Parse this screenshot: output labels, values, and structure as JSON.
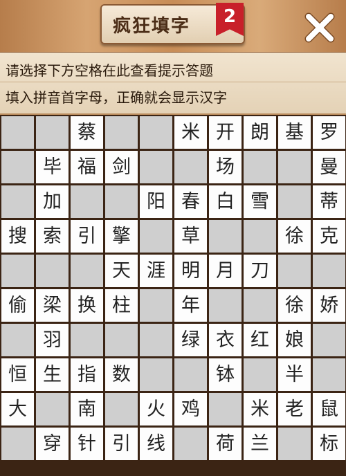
{
  "header": {
    "title": "疯狂填字",
    "badge": "2",
    "close_icon": "close-x-icon"
  },
  "hint": {
    "line1": "请选择下方空格在此查看提示答题",
    "line2": "填入拼音首字母，正确就会显示汉字"
  },
  "colors": {
    "board_border": "#3b2414",
    "blocked_cell": "#cfcfcf",
    "open_cell": "#fdfdfd",
    "badge": "#c8202a"
  },
  "grid": [
    [
      "#",
      "#",
      "蔡",
      "#",
      "#",
      "米",
      "开",
      "朗",
      "基",
      "罗"
    ],
    [
      "#",
      "毕",
      "福",
      "剑",
      "#",
      "#",
      "场",
      "#",
      "#",
      "曼"
    ],
    [
      "#",
      "加",
      "#",
      "#",
      "阳",
      "春",
      "白",
      "雪",
      "#",
      "蒂"
    ],
    [
      "搜",
      "索",
      "引",
      "擎",
      "#",
      "草",
      "#",
      "#",
      "徐",
      "克"
    ],
    [
      "#",
      "#",
      "#",
      "天",
      "涯",
      "明",
      "月",
      "刀",
      "#",
      "#"
    ],
    [
      "偷",
      "梁",
      "换",
      "柱",
      "#",
      "年",
      "#",
      "#",
      "徐",
      "娇"
    ],
    [
      "#",
      "羽",
      "#",
      "#",
      "#",
      "绿",
      "衣",
      "红",
      "娘",
      "#"
    ],
    [
      "恒",
      "生",
      "指",
      "数",
      "#",
      "#",
      "钵",
      "#",
      "半",
      "#"
    ],
    [
      "大",
      "#",
      "南",
      "#",
      "火",
      "鸡",
      "#",
      "米",
      "老",
      "鼠"
    ],
    [
      "#",
      "穿",
      "针",
      "引",
      "线",
      "#",
      "荷",
      "兰",
      "#",
      "标"
    ]
  ]
}
